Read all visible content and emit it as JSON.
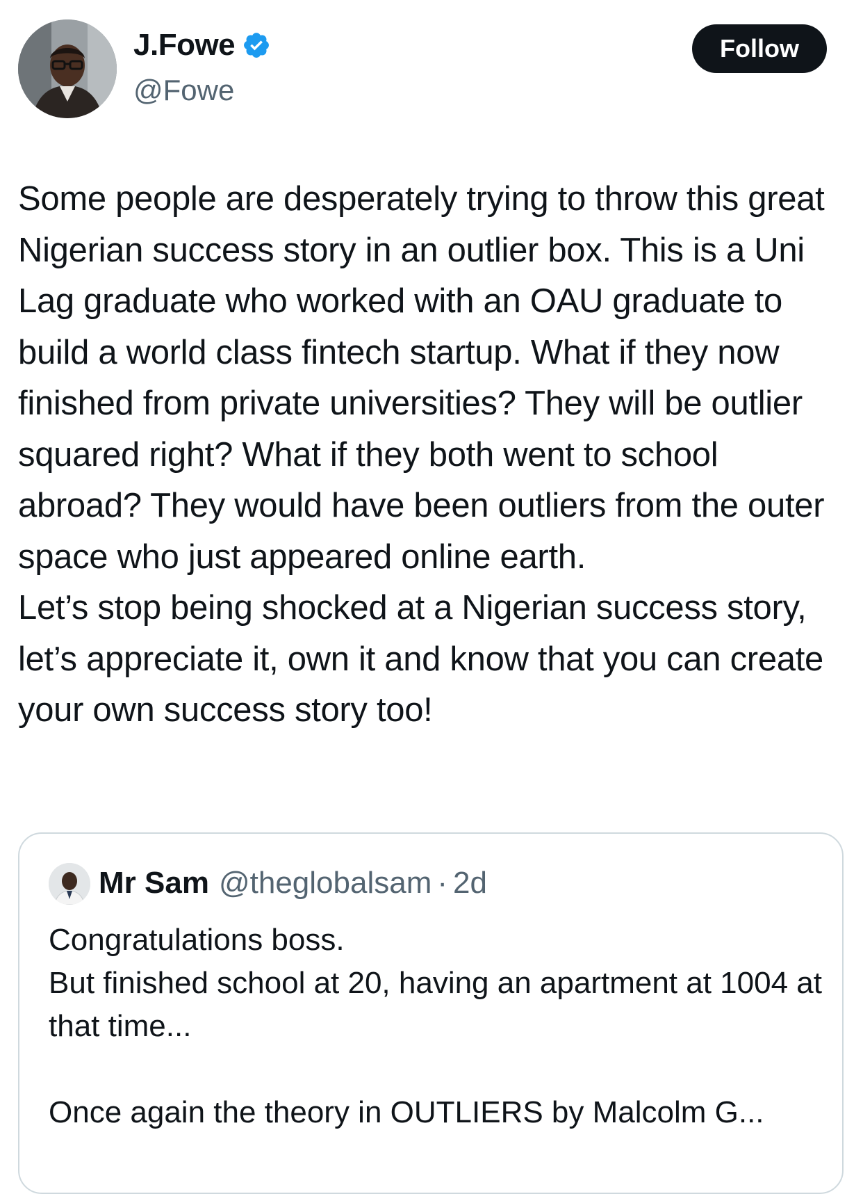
{
  "author": {
    "display_name": "J.Fowe",
    "handle": "@Fowe",
    "verified": true,
    "avatar_icon": "profile-photo-icon",
    "verified_icon": "verified-badge-icon"
  },
  "actions": {
    "follow_label": "Follow"
  },
  "tweet": {
    "text": "Some people are desperately trying to throw this great Nigerian success story in an outlier box. This is a Uni Lag graduate who worked with an OAU graduate to build a world class fintech startup. What if they now finished from private universities? They will be outlier squared right? What if they both went to school abroad? They would have been outliers from the outer space who just appeared online earth.\nLet’s stop being shocked at a Nigerian success story, let’s appreciate it, own it and know that you can create your own success story too!"
  },
  "quote": {
    "display_name": "Mr Sam",
    "handle": "@theglobalsam",
    "separator": "·",
    "time": "2d",
    "text": "Congratulations boss.\nBut finished school at 20, having an apartment at 1004 at that time...\n\nOnce again the theory in OUTLIERS by Malcolm G..."
  },
  "colors": {
    "text_primary": "#0f1419",
    "text_secondary": "#536471",
    "verified_blue": "#1d9bf0",
    "follow_button_bg": "#0f1419",
    "border": "#cfd9de"
  }
}
